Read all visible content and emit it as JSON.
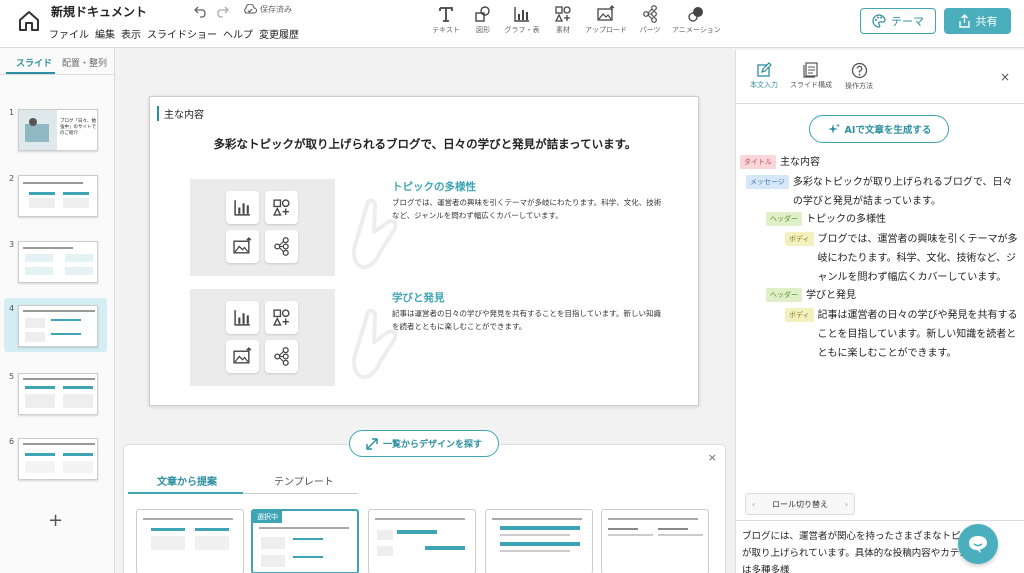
{
  "header": {
    "title": "新規ドキュメント",
    "save_status": "保存済み",
    "menu": [
      "ファイル",
      "編集",
      "表示",
      "スライドショー",
      "ヘルプ",
      "変更履歴"
    ],
    "tools": [
      {
        "label": "テキスト",
        "icon": "text-icon"
      },
      {
        "label": "図形",
        "icon": "shapes-icon"
      },
      {
        "label": "グラフ・表",
        "icon": "chart-icon"
      },
      {
        "label": "素材",
        "icon": "materials-icon"
      },
      {
        "label": "アップロード",
        "icon": "upload-image-icon"
      },
      {
        "label": "パーツ",
        "icon": "parts-icon"
      },
      {
        "label": "アニメーション",
        "icon": "animation-icon"
      }
    ],
    "theme_label": "テーマ",
    "share_label": "共有"
  },
  "left_panel": {
    "tabs": [
      "スライド",
      "配置・整列"
    ],
    "slides": [
      {
        "number": "1",
        "caption": "ブログ「日々、勉強中」のサイトでのご紹介"
      },
      {
        "number": "2"
      },
      {
        "number": "3"
      },
      {
        "number": "4"
      },
      {
        "number": "5"
      },
      {
        "number": "6"
      }
    ],
    "selected_slide": "4",
    "add_label": "+"
  },
  "slide": {
    "title": "主な内容",
    "message": "多彩なトピックが取り上げられるブログで、日々の学びと発見が詰まっています。",
    "sections": [
      {
        "header": "トピックの多様性",
        "body": "ブログでは、運営者の興味を引くテーマが多岐にわたります。科学、文化、技術など、ジャンルを問わず幅広くカバーしています。"
      },
      {
        "header": "学びと発見",
        "body": "記事は運営者の日々の学びや発見を共有することを目指しています。新しい知識を読者とともに楽しむことができます。"
      }
    ]
  },
  "design_button": "一覧からデザインを探す",
  "bottom_panel": {
    "tabs": [
      "文章から提案",
      "テンプレート"
    ],
    "selected_badge": "選択中",
    "close": "×"
  },
  "right_panel": {
    "tabs": [
      {
        "label": "本文入力",
        "icon": "edit-text-icon"
      },
      {
        "label": "スライド構成",
        "icon": "slides-structure-icon"
      },
      {
        "label": "操作方法",
        "icon": "help-icon"
      }
    ],
    "close": "×",
    "ai_button": "AIで文章を生成する",
    "outline": [
      {
        "role": "タイトル",
        "text": "主な内容"
      },
      {
        "role": "メッセージ",
        "text": "多彩なトピックが取り上げられるブログで、日々の学びと発見が詰まっています。"
      },
      {
        "role": "ヘッダー",
        "text": "トピックの多様性"
      },
      {
        "role": "ボディ",
        "text": "ブログでは、運営者の興味を引くテーマが多岐にわたります。科学、文化、技術など、ジャンルを問わず幅広くカバーしています。"
      },
      {
        "role": "ヘッダー",
        "text": "学びと発見"
      },
      {
        "role": "ボディ",
        "text": "記事は運営者の日々の学びや発見を共有することを目指しています。新しい知識を読者とともに楽しむことができます。"
      }
    ],
    "role_switch": "ロール切り替え",
    "note": "ブログには、運営者が関心を持ったさまざまなトピックが取り上げられています。具体的な投稿内容やカテゴリは多種多様"
  },
  "colors": {
    "accent": "#3fa5b5",
    "accent_dark": "#2c8fa0",
    "selected_bg": "#d5eef3"
  }
}
